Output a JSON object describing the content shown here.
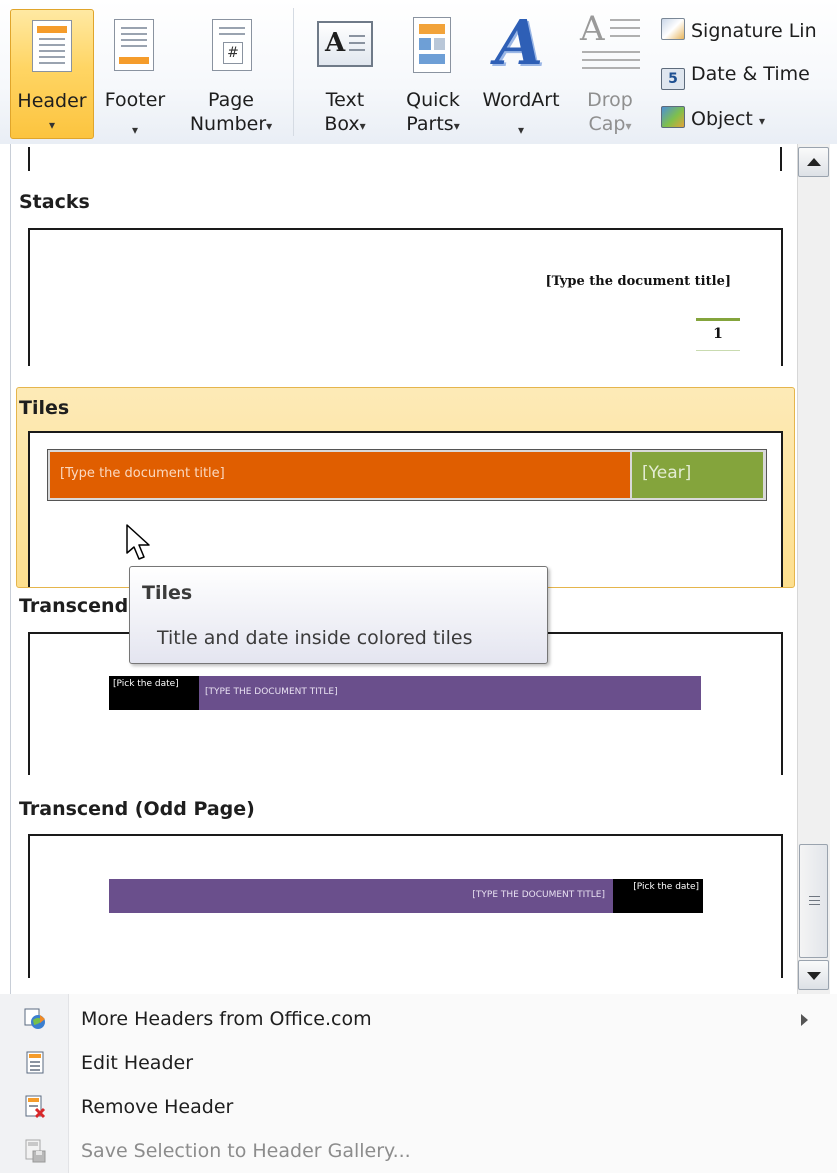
{
  "ribbon": {
    "header": {
      "line1": "Header",
      "arrow": "▾"
    },
    "footer": {
      "line1": "Footer",
      "arrow": "▾"
    },
    "page_number": {
      "line1": "Page",
      "line2": "Number",
      "arrow": "▾"
    },
    "text_box": {
      "line1": "Text",
      "line2": "Box",
      "arrow": "▾"
    },
    "quick_parts": {
      "line1": "Quick",
      "line2": "Parts",
      "arrow": "▾"
    },
    "wordart": {
      "line1": "WordArt",
      "arrow": "▾"
    },
    "drop_cap": {
      "line1": "Drop",
      "line2": "Cap",
      "arrow": "▾"
    },
    "signature_line": "Signature Lin",
    "date_time": "Date & Time",
    "object": "Object",
    "object_arrow": "▾",
    "icon_text": {
      "text_box": "A",
      "page_number": "#",
      "wordart": "A",
      "drop_cap": "A",
      "date_time": "5"
    }
  },
  "gallery": {
    "sections": [
      {
        "title": "Stacks",
        "sample_title": "[Type the document title]",
        "sample_page": "1"
      },
      {
        "title": "Tiles",
        "sample_title": "[Type the document title]",
        "sample_year": "[Year]"
      },
      {
        "title": "Transcend",
        "sample_date": "[Pick the date]",
        "sample_title": "[TYPE THE DOCUMENT TITLE]"
      },
      {
        "title": "Transcend (Odd Page)",
        "sample_date": "[Pick the date]",
        "sample_title": "[TYPE THE DOCUMENT TITLE]"
      }
    ]
  },
  "tooltip": {
    "title": "Tiles",
    "description": "Title and date inside colored tiles"
  },
  "menu": {
    "items": [
      {
        "label": "More Headers from Office.com",
        "icon": "office-globe-icon",
        "has_submenu": true
      },
      {
        "label": "Edit Header",
        "icon": "edit-header-icon"
      },
      {
        "label": "Remove Header",
        "icon": "remove-header-icon"
      },
      {
        "label": "Save Selection to Header Gallery...",
        "icon": "save-selection-icon",
        "disabled": true
      }
    ]
  },
  "colors": {
    "selected_button": "#fcc43f",
    "tiles_orange": "#e05e00",
    "tiles_green": "#84a43c",
    "transcend_purple": "#6a4f8c",
    "stacks_rule_green": "#84a43c"
  }
}
